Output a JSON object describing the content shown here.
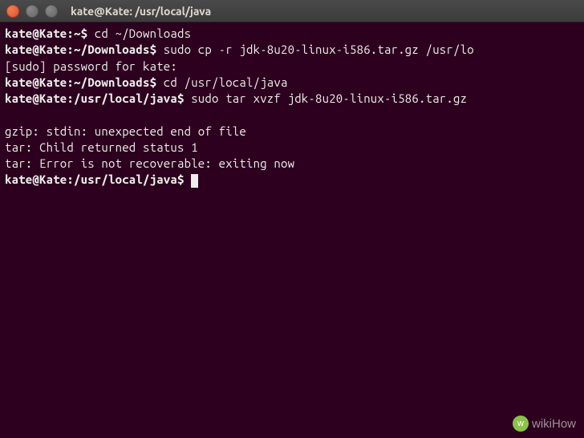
{
  "window": {
    "title": "kate@Kate: /usr/local/java"
  },
  "terminal": {
    "lines": [
      {
        "prompt": "kate@Kate:~$",
        "cmd": " cd ~/Downloads"
      },
      {
        "prompt": "kate@Kate:~/Downloads$",
        "cmd": " sudo cp -r jdk-8u20-linux-i586.tar.gz /usr/lo"
      },
      {
        "text": "[sudo] password for kate:"
      },
      {
        "prompt": "kate@Kate:~/Downloads$",
        "cmd": " cd /usr/local/java"
      },
      {
        "prompt": "kate@Kate:/usr/local/java$",
        "cmd": " sudo tar xvzf jdk-8u20-linux-i586.tar.gz"
      },
      {
        "text": ""
      },
      {
        "text": "gzip: stdin: unexpected end of file"
      },
      {
        "text": "tar: Child returned status 1"
      },
      {
        "text": "tar: Error is not recoverable: exiting now"
      },
      {
        "prompt": "kate@Kate:/usr/local/java$",
        "cmd": " ",
        "cursor": true
      }
    ]
  },
  "watermark": {
    "text": "wikiHow"
  }
}
